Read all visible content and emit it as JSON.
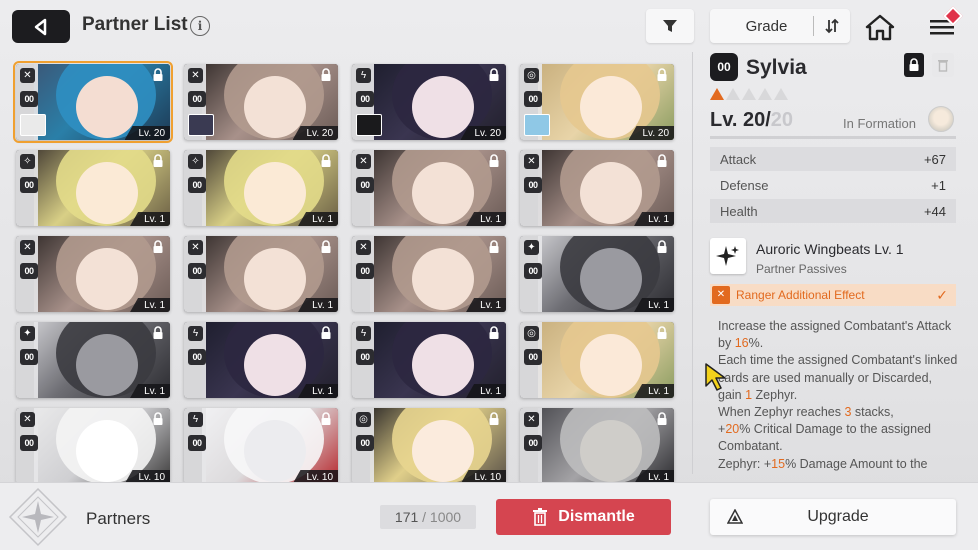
{
  "header": {
    "title": "Partner List",
    "info_icon": "ⓘ",
    "sort_label": "Grade"
  },
  "grid": {
    "cards": [
      {
        "cls": "✕",
        "rank": "00",
        "level": "Lv. 20",
        "selected": true,
        "art": "blue",
        "mini": "white"
      },
      {
        "cls": "✕",
        "rank": "00",
        "level": "Lv. 20",
        "selected": false,
        "art": "brown",
        "mini": "dark"
      },
      {
        "cls": "ϟ",
        "rank": "00",
        "level": "Lv. 20",
        "selected": false,
        "art": "purple",
        "mini": "black"
      },
      {
        "cls": "◎",
        "rank": "00",
        "level": "Lv. 20",
        "selected": false,
        "art": "blonde",
        "mini": "cyan"
      },
      {
        "cls": "✧",
        "rank": "00",
        "level": "Lv. 1",
        "selected": false,
        "art": "yellow"
      },
      {
        "cls": "✧",
        "rank": "00",
        "level": "Lv. 1",
        "selected": false,
        "art": "yellow"
      },
      {
        "cls": "✕",
        "rank": "00",
        "level": "Lv. 1",
        "selected": false,
        "art": "brown"
      },
      {
        "cls": "✕",
        "rank": "00",
        "level": "Lv. 1",
        "selected": false,
        "art": "brown"
      },
      {
        "cls": "✕",
        "rank": "00",
        "level": "Lv. 1",
        "selected": false,
        "art": "brown"
      },
      {
        "cls": "✕",
        "rank": "00",
        "level": "Lv. 1",
        "selected": false,
        "art": "brown"
      },
      {
        "cls": "✕",
        "rank": "00",
        "level": "Lv. 1",
        "selected": false,
        "art": "brown"
      },
      {
        "cls": "✦",
        "rank": "00",
        "level": "Lv. 1",
        "selected": false,
        "art": "mech"
      },
      {
        "cls": "✦",
        "rank": "00",
        "level": "Lv. 1",
        "selected": false,
        "art": "mech"
      },
      {
        "cls": "ϟ",
        "rank": "00",
        "level": "Lv. 1",
        "selected": false,
        "art": "purple"
      },
      {
        "cls": "ϟ",
        "rank": "00",
        "level": "Lv. 1",
        "selected": false,
        "art": "purple"
      },
      {
        "cls": "◎",
        "rank": "00",
        "level": "Lv. 1",
        "selected": false,
        "art": "blonde"
      },
      {
        "cls": "✕",
        "rank": "00",
        "level": "Lv. 10",
        "selected": false,
        "art": "bunny"
      },
      {
        "cls": "ϟ",
        "rank": "00",
        "level": "Lv. 10",
        "selected": false,
        "art": "white"
      },
      {
        "cls": "◎",
        "rank": "00",
        "level": "Lv. 10",
        "selected": false,
        "art": "gold"
      },
      {
        "cls": "✕",
        "rank": "00",
        "level": "Lv. 1",
        "selected": false,
        "art": "bear"
      }
    ]
  },
  "detail": {
    "rank": "00",
    "name": "Sylvia",
    "stars_filled": 1,
    "stars_total": 5,
    "level_current": "Lv. 20/",
    "level_max": "20",
    "formation_label": "In Formation",
    "stats": [
      {
        "label": "Attack",
        "value": "+67"
      },
      {
        "label": "Defense",
        "value": "+1"
      },
      {
        "label": "Health",
        "value": "+44"
      }
    ],
    "passive_name": "Auroric Wingbeats Lv. 1",
    "passive_sub": "Partner Passives",
    "effect_label": "Ranger Additional Effect",
    "desc": {
      "p1a": "Increase the assigned Combatant's Attack by ",
      "p1h": "16",
      "p1b": "%.",
      "p2a": "Each time the assigned Combatant's linked cards are used manually or Discarded, gain ",
      "p2h": "1",
      "p2b": " Zephyr.",
      "p3a": "When Zephyr reaches ",
      "p3h": "3",
      "p3b": " stacks,",
      "p4a": "+",
      "p4h": "20",
      "p4b": "% Critical Damage to the assigned Combatant.",
      "p5a": "Zephyr: +",
      "p5h": "15",
      "p5b": "% Damage Amount to the assigned Combatant's Ranger Attack"
    }
  },
  "footer": {
    "title": "Partners",
    "count": "171",
    "count_total": " / 1000",
    "dismantle_label": "Dismantle",
    "upgrade_label": "Upgrade"
  },
  "colors": {
    "accent": "#e26a1f",
    "dismantle": "#d54550",
    "selected_outline": "#f0a030"
  }
}
